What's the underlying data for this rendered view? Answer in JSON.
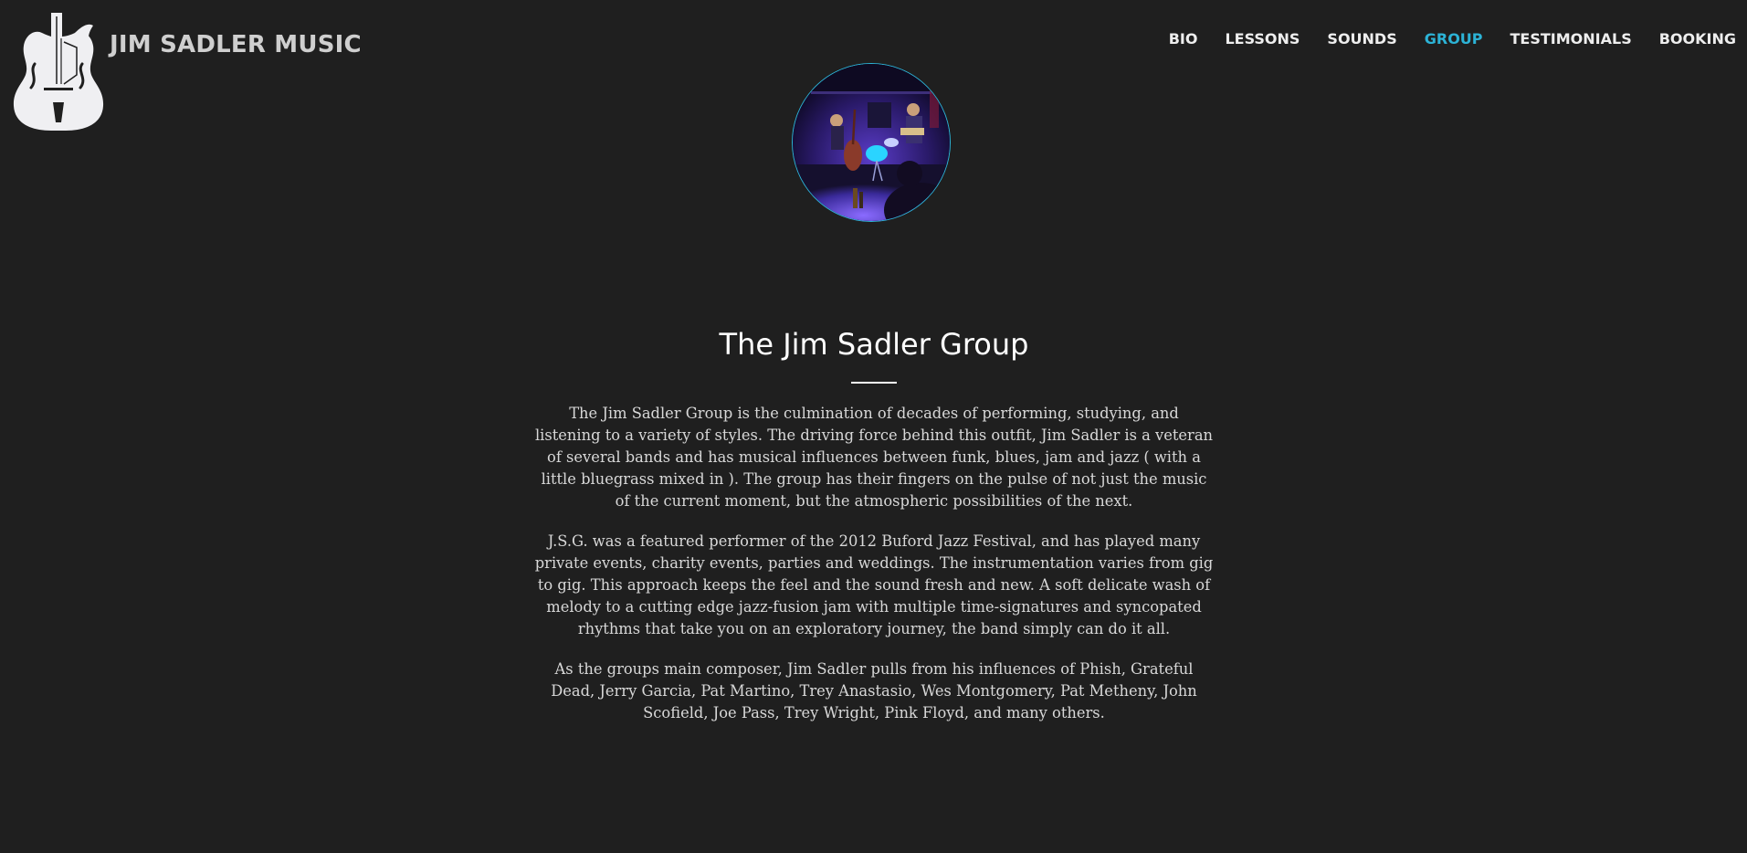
{
  "header": {
    "brand": "JIM SADLER MUSIC",
    "logo_icon": "archtop-guitar-icon"
  },
  "nav": {
    "items": [
      {
        "label": "BIO",
        "active": false
      },
      {
        "label": "LESSONS",
        "active": false
      },
      {
        "label": "SOUNDS",
        "active": false
      },
      {
        "label": "GROUP",
        "active": true
      },
      {
        "label": "TESTIMONIALS",
        "active": false
      },
      {
        "label": "BOOKING",
        "active": false
      }
    ]
  },
  "colors": {
    "background": "#1f1f1f",
    "accent": "#2cb3d6",
    "heading": "#ffffff",
    "body_text": "#d8d8d8"
  },
  "main": {
    "title": "The Jim Sadler Group",
    "paragraphs": [
      "The Jim Sadler Group is the culmination of decades of performing, studying, and listening to a variety of styles. The driving force behind this outfit, Jim Sadler is a veteran of several bands and has musical influences between funk, blues, jam and jazz ( with a little bluegrass mixed in ). The group has their fingers on the pulse of not just the music of the current moment, but the atmospheric possibilities of the next.",
      "J.S.G. was a featured performer of the 2012 Buford Jazz Festival, and has played many private events, charity events, parties and weddings. The instrumentation varies from gig to gig. This approach keeps the feel and the sound fresh and new. A soft delicate wash of melody to a cutting edge jazz-fusion jam with multiple time-signatures and syncopated rhythms that take you on an exploratory journey, the band simply can do it all.",
      "As the groups main composer, Jim Sadler pulls from his influences of Phish, Grateful Dead, Jerry Garcia, Pat Martino, Trey Anastasio, Wes Montgomery, Pat Metheny, John Scofield, Joe Pass, Trey Wright, Pink Floyd, and many others."
    ]
  }
}
